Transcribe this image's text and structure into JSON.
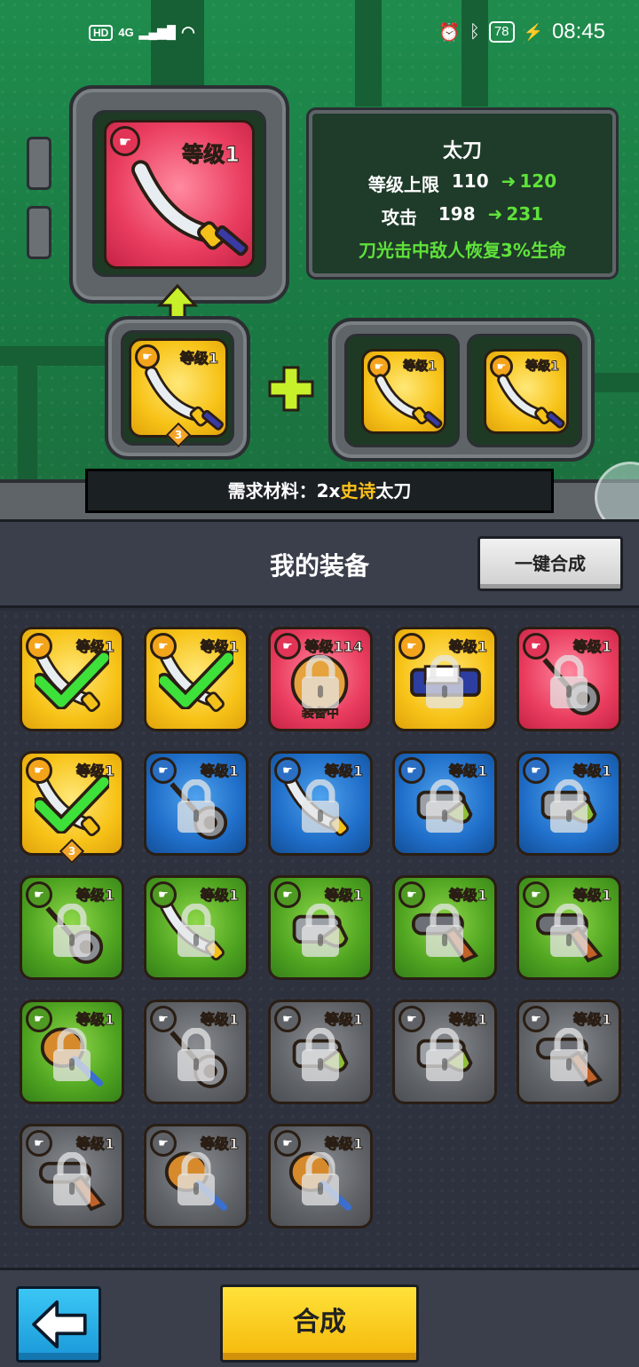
{
  "status_bar": {
    "hd": "HD",
    "network": "4G",
    "time": "08:45",
    "battery": "78"
  },
  "main_item": {
    "level": "等级1",
    "name": "太刀",
    "rarity_color": "#ea3d5f",
    "stats": {
      "level_cap_label": "等级上限",
      "level_cap_from": "110",
      "level_cap_to": "120",
      "attack_label": "攻击",
      "attack_from": "198",
      "attack_to": "231",
      "effect": "刀光击中敌人恢复3%生命"
    }
  },
  "source_item": {
    "level": "等级1",
    "stars": "3"
  },
  "material_items": [
    {
      "level": "等级1"
    },
    {
      "level": "等级1"
    }
  ],
  "requirement": {
    "prefix": "需求材料：",
    "count": "2x",
    "rarity": "史诗",
    "item": "太刀"
  },
  "inventory": {
    "title": "我的装备",
    "merge_all_label": "一键合成",
    "items": [
      {
        "level": "等级1",
        "color": "yellow",
        "icon": "katana-icon",
        "state": "selected"
      },
      {
        "level": "等级1",
        "color": "yellow",
        "icon": "katana-icon",
        "state": "selected"
      },
      {
        "level": "等级114",
        "color": "red",
        "icon": "burger-icon",
        "state": "locked",
        "tag": "装备中"
      },
      {
        "level": "等级1",
        "color": "yellow",
        "icon": "gun-icon",
        "state": "locked"
      },
      {
        "level": "等级1",
        "color": "red",
        "icon": "yoyo-icon",
        "state": "locked"
      },
      {
        "level": "等级1",
        "color": "yellow",
        "icon": "katana-icon",
        "state": "selected",
        "stars": "3"
      },
      {
        "level": "等级1",
        "color": "blue",
        "icon": "yoyo-icon",
        "state": "locked"
      },
      {
        "level": "等级1",
        "color": "blue",
        "icon": "katana-icon",
        "state": "locked"
      },
      {
        "level": "等级1",
        "color": "blue",
        "icon": "watergun-icon",
        "state": "locked"
      },
      {
        "level": "等级1",
        "color": "blue",
        "icon": "watergun-icon",
        "state": "locked"
      },
      {
        "level": "等级1",
        "color": "green",
        "icon": "yoyo-icon",
        "state": "locked"
      },
      {
        "level": "等级1",
        "color": "green",
        "icon": "katana-icon",
        "state": "locked"
      },
      {
        "level": "等级1",
        "color": "green",
        "icon": "watergun-icon",
        "state": "locked"
      },
      {
        "level": "等级1",
        "color": "green",
        "icon": "pistol-icon",
        "state": "locked"
      },
      {
        "level": "等级1",
        "color": "green",
        "icon": "pistol-icon",
        "state": "locked"
      },
      {
        "level": "等级1",
        "color": "green",
        "icon": "drumstick-icon",
        "state": "locked"
      },
      {
        "level": "等级1",
        "color": "gray",
        "icon": "yoyo-icon",
        "state": "locked"
      },
      {
        "level": "等级1",
        "color": "gray",
        "icon": "watergun-icon",
        "state": "locked"
      },
      {
        "level": "等级1",
        "color": "gray",
        "icon": "watergun-icon",
        "state": "locked"
      },
      {
        "level": "等级1",
        "color": "gray",
        "icon": "pistol-icon",
        "state": "locked"
      },
      {
        "level": "等级1",
        "color": "gray",
        "icon": "pistol-icon",
        "state": "locked"
      },
      {
        "level": "等级1",
        "color": "gray",
        "icon": "drumstick-icon",
        "state": "locked"
      },
      {
        "level": "等级1",
        "color": "gray",
        "icon": "drumstick-icon",
        "state": "locked"
      }
    ]
  },
  "bottom": {
    "back_icon": "back-arrow-icon",
    "merge_label": "合成"
  }
}
